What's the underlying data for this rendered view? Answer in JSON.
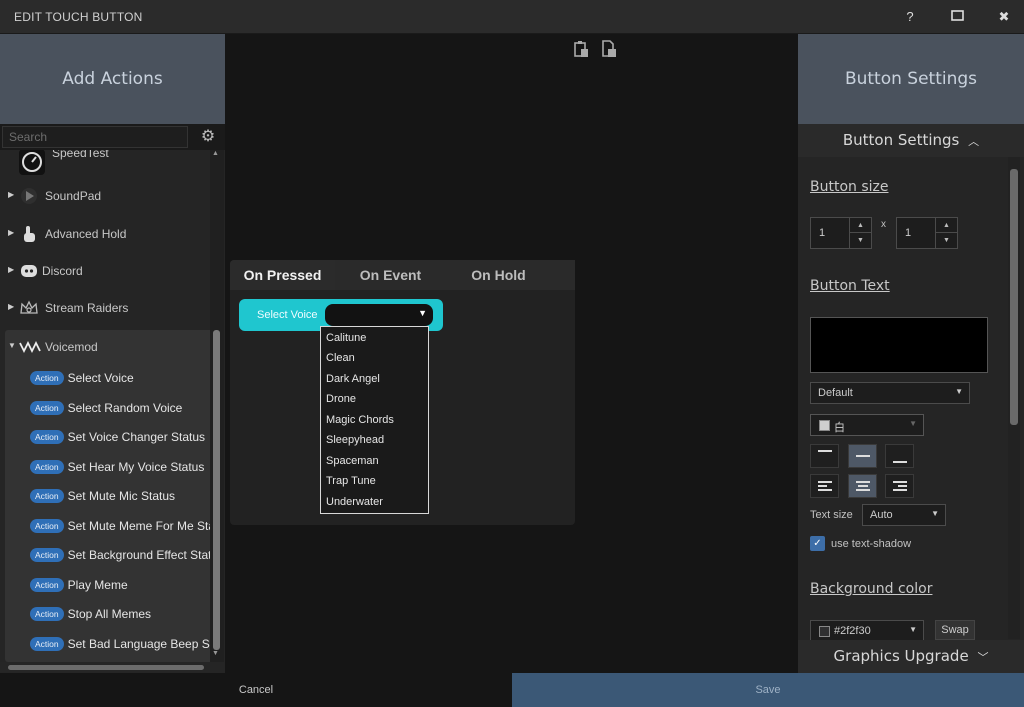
{
  "window": {
    "title": "EDIT TOUCH BUTTON",
    "help": "?",
    "maximize": "☐",
    "close": "✖"
  },
  "left_panel": {
    "header": "Add Actions",
    "search_placeholder": "Search",
    "tree": [
      {
        "label": "SpeedTest",
        "icon": "speedometer-icon"
      },
      {
        "label": "SoundPad",
        "icon": "play-icon"
      },
      {
        "label": "Advanced Hold",
        "icon": "hand-pointer-icon"
      },
      {
        "label": "Discord",
        "icon": "discord-icon"
      },
      {
        "label": "Stream Raiders",
        "icon": "crown-icon"
      },
      {
        "label": "Voicemod",
        "icon": "voicemod-icon"
      }
    ],
    "badge_label": "Action",
    "actions": [
      "Select Voice",
      "Select Random Voice",
      "Set Voice Changer Status",
      "Set Hear My Voice Status",
      "Set Mute Mic Status",
      "Set Mute Meme For Me Status",
      "Set Background Effect Status",
      "Play Meme",
      "Stop All Memes",
      "Set Bad Language Beep Status"
    ]
  },
  "center": {
    "tabs": [
      "On Pressed",
      "On Event",
      "On Hold"
    ],
    "active_tab": "On Pressed",
    "select_voice_label": "Select Voice",
    "select_voice_value": "",
    "voice_options": [
      "Calitune",
      "Clean",
      "Dark Angel",
      "Drone",
      "Magic Chords",
      "Sleepyhead",
      "Spaceman",
      "Trap Tune",
      "Underwater"
    ]
  },
  "right_panel": {
    "header": "Button Settings",
    "section_bar": "Button Settings",
    "button_size_title": "Button size",
    "width_value": "1",
    "height_value": "1",
    "size_separator": "x",
    "button_text_title": "Button Text",
    "font_select": "Default",
    "text_color_label": "白",
    "text_size_label": "Text size",
    "text_size_value": "Auto",
    "text_shadow_label": "use text-shadow",
    "text_shadow_checked": true,
    "background_color_title": "Background color",
    "background_color_value": "#2f2f30",
    "swap_label": "Swap",
    "graphics_upgrade": "Graphics Upgrade"
  },
  "footer": {
    "cancel": "Cancel",
    "save": "Save"
  },
  "colors": {
    "accent_cyan": "#1fc6cf",
    "action_badge": "#2f6fb7",
    "save_bar": "#3b5876",
    "panel_header": "#4a525d"
  }
}
